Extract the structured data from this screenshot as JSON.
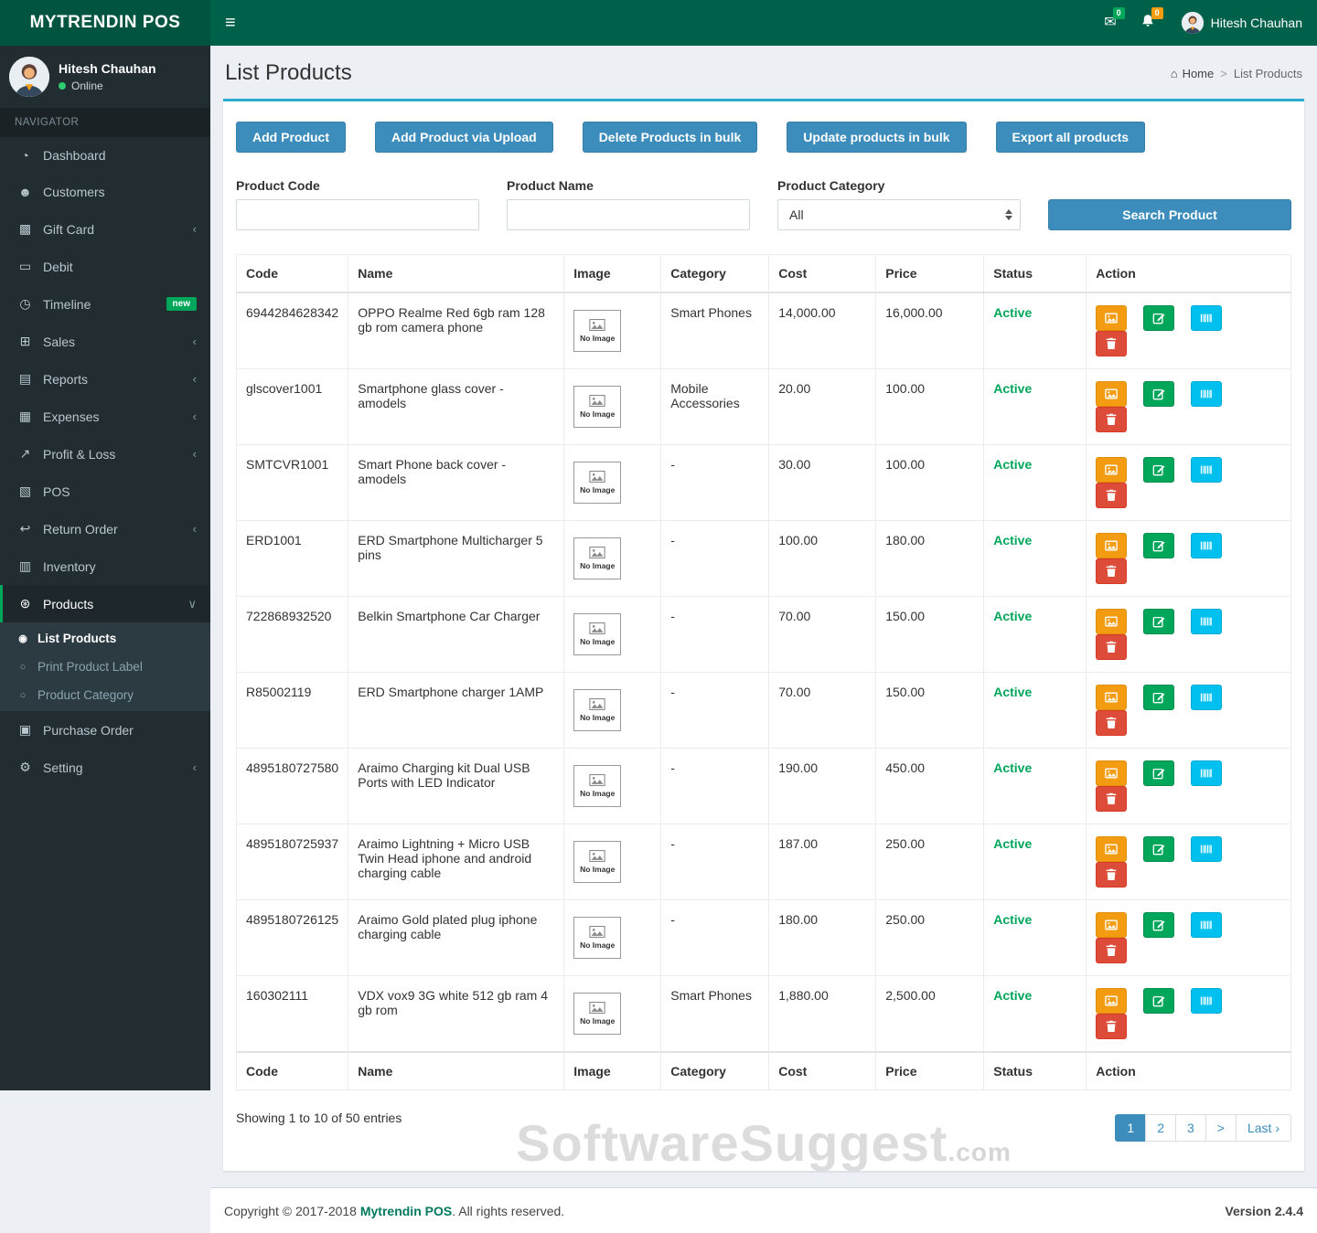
{
  "theme": {
    "navbar_green": "#00614a",
    "logo_green": "#005440",
    "sidebar_dark": "#222d32",
    "sidebar_text": "#b8c7ce",
    "bg": "#ecf0f5",
    "accent_blue": "#3c8dbc",
    "box_top_line": "#2aabd2",
    "status_green": "#00a65a",
    "btn_orange": "#f39c12",
    "btn_green": "#00a65a",
    "btn_cyan": "#00c0ef",
    "btn_red": "#dd4b39",
    "badge_green": "#00a65a",
    "badge_orange": "#f39c12",
    "brand_link": "#00795f"
  },
  "icons": {
    "hamburger": "≡",
    "envelope": "✉",
    "home": "⌂"
  },
  "navbar": {
    "brand": "MYTRENDIN POS",
    "messages_count": "0",
    "notifications_count": "0",
    "user_name": "Hitesh Chauhan"
  },
  "sidebar": {
    "user": {
      "name": "Hitesh Chauhan",
      "status": "Online"
    },
    "section_label": "NAVIGATOR",
    "items": [
      {
        "id": "dashboard",
        "label": "Dashboard",
        "icon": "dashboard-icon",
        "glyph": "◔"
      },
      {
        "id": "customers",
        "label": "Customers",
        "icon": "customers-icon",
        "glyph": "☻"
      },
      {
        "id": "gift-card",
        "label": "Gift Card",
        "icon": "gift-card-icon",
        "glyph": "▩",
        "arrow": "‹"
      },
      {
        "id": "debit",
        "label": "Debit",
        "icon": "debit-card-icon",
        "glyph": "▭"
      },
      {
        "id": "timeline",
        "label": "Timeline",
        "icon": "clock-icon",
        "glyph": "◷",
        "badge": "new"
      },
      {
        "id": "sales",
        "label": "Sales",
        "icon": "cart-icon",
        "glyph": "⊞",
        "arrow": "‹"
      },
      {
        "id": "reports",
        "label": "Reports",
        "icon": "reports-icon",
        "glyph": "▤",
        "arrow": "‹"
      },
      {
        "id": "expenses",
        "label": "Expenses",
        "icon": "expenses-icon",
        "glyph": "▦",
        "arrow": "‹"
      },
      {
        "id": "profit-loss",
        "label": "Profit & Loss",
        "icon": "chart-icon",
        "glyph": "↗",
        "arrow": "‹"
      },
      {
        "id": "pos",
        "label": "POS",
        "icon": "pos-icon",
        "glyph": "▧"
      },
      {
        "id": "return-order",
        "label": "Return Order",
        "icon": "return-icon",
        "glyph": "↩",
        "arrow": "‹"
      },
      {
        "id": "inventory",
        "label": "Inventory",
        "icon": "inventory-icon",
        "glyph": "▥"
      },
      {
        "id": "products",
        "label": "Products",
        "icon": "products-icon",
        "glyph": "⊛",
        "arrow": "∨",
        "active": true,
        "children": [
          {
            "id": "list-products",
            "label": "List Products",
            "glyph": "◉",
            "active": true
          },
          {
            "id": "print-product-label",
            "label": "Print Product Label",
            "glyph": "○"
          },
          {
            "id": "product-category",
            "label": "Product Category",
            "glyph": "○"
          }
        ]
      },
      {
        "id": "purchase-order",
        "label": "Purchase Order",
        "icon": "purchase-order-icon",
        "glyph": "▣"
      },
      {
        "id": "setting",
        "label": "Setting",
        "icon": "gear-icon",
        "glyph": "⚙",
        "arrow": "‹"
      }
    ]
  },
  "page": {
    "title": "List Products",
    "breadcrumb": {
      "home": "Home",
      "separator": ">",
      "current": "List Products"
    }
  },
  "toolbar": {
    "buttons": [
      {
        "id": "add-product",
        "label": "Add Product"
      },
      {
        "id": "add-product-via-upload",
        "label": "Add Product via Upload"
      },
      {
        "id": "delete-products-in-bulk",
        "label": "Delete Products in bulk"
      },
      {
        "id": "update-products-in-bulk",
        "label": "Update products in bulk"
      },
      {
        "id": "export-all-products",
        "label": "Export all products"
      }
    ]
  },
  "filters": {
    "product_code_label": "Product Code",
    "product_code_value": "",
    "product_name_label": "Product Name",
    "product_name_value": "",
    "product_category_label": "Product Category",
    "product_category_value": "All",
    "search_button_label": "Search Product"
  },
  "table": {
    "headers": [
      "Code",
      "Name",
      "Image",
      "Category",
      "Cost",
      "Price",
      "Status",
      "Action"
    ],
    "no_image_label": "No Image",
    "rows": [
      {
        "code": "6944284628342",
        "name": "OPPO Realme Red 6gb ram 128 gb rom camera phone",
        "category": "Smart Phones",
        "cost": "14,000.00",
        "price": "16,000.00",
        "status": "Active"
      },
      {
        "code": "glscover1001",
        "name": "Smartphone glass cover - amodels",
        "category": "Mobile Accessories",
        "cost": "20.00",
        "price": "100.00",
        "status": "Active"
      },
      {
        "code": "SMTCVR1001",
        "name": "Smart Phone back cover - amodels",
        "category": "-",
        "cost": "30.00",
        "price": "100.00",
        "status": "Active"
      },
      {
        "code": "ERD1001",
        "name": "ERD Smartphone Multicharger 5 pins",
        "category": "-",
        "cost": "100.00",
        "price": "180.00",
        "status": "Active"
      },
      {
        "code": "722868932520",
        "name": "Belkin Smartphone Car Charger",
        "category": "-",
        "cost": "70.00",
        "price": "150.00",
        "status": "Active"
      },
      {
        "code": "R85002119",
        "name": "ERD Smartphone charger 1AMP",
        "category": "-",
        "cost": "70.00",
        "price": "150.00",
        "status": "Active"
      },
      {
        "code": "4895180727580",
        "name": "Araimo Charging kit Dual USB Ports with LED Indicator",
        "category": "-",
        "cost": "190.00",
        "price": "450.00",
        "status": "Active"
      },
      {
        "code": "4895180725937",
        "name": "Araimo Lightning + Micro USB Twin Head iphone and android charging cable",
        "category": "-",
        "cost": "187.00",
        "price": "250.00",
        "status": "Active"
      },
      {
        "code": "4895180726125",
        "name": "Araimo Gold plated plug iphone charging cable",
        "category": "-",
        "cost": "180.00",
        "price": "250.00",
        "status": "Active"
      },
      {
        "code": "160302111",
        "name": "VDX vox9 3G white 512 gb ram 4 gb rom",
        "category": "Smart Phones",
        "cost": "1,880.00",
        "price": "2,500.00",
        "status": "Active"
      }
    ]
  },
  "pagination": {
    "summary": "Showing 1 to 10 of 50 entries",
    "pages": [
      {
        "id": "1",
        "label": "1",
        "active": true
      },
      {
        "id": "2",
        "label": "2"
      },
      {
        "id": "3",
        "label": "3"
      },
      {
        "id": "next",
        "label": ">"
      },
      {
        "id": "last",
        "label": "Last ›"
      }
    ]
  },
  "watermark": {
    "text": "SoftwareSuggest",
    "suffix": ".com"
  },
  "footer": {
    "copyright_prefix": "Copyright © 2017-2018 ",
    "brand": "Mytrendin POS",
    "copyright_suffix": ". All rights reserved.",
    "version": "Version 2.4.4"
  }
}
